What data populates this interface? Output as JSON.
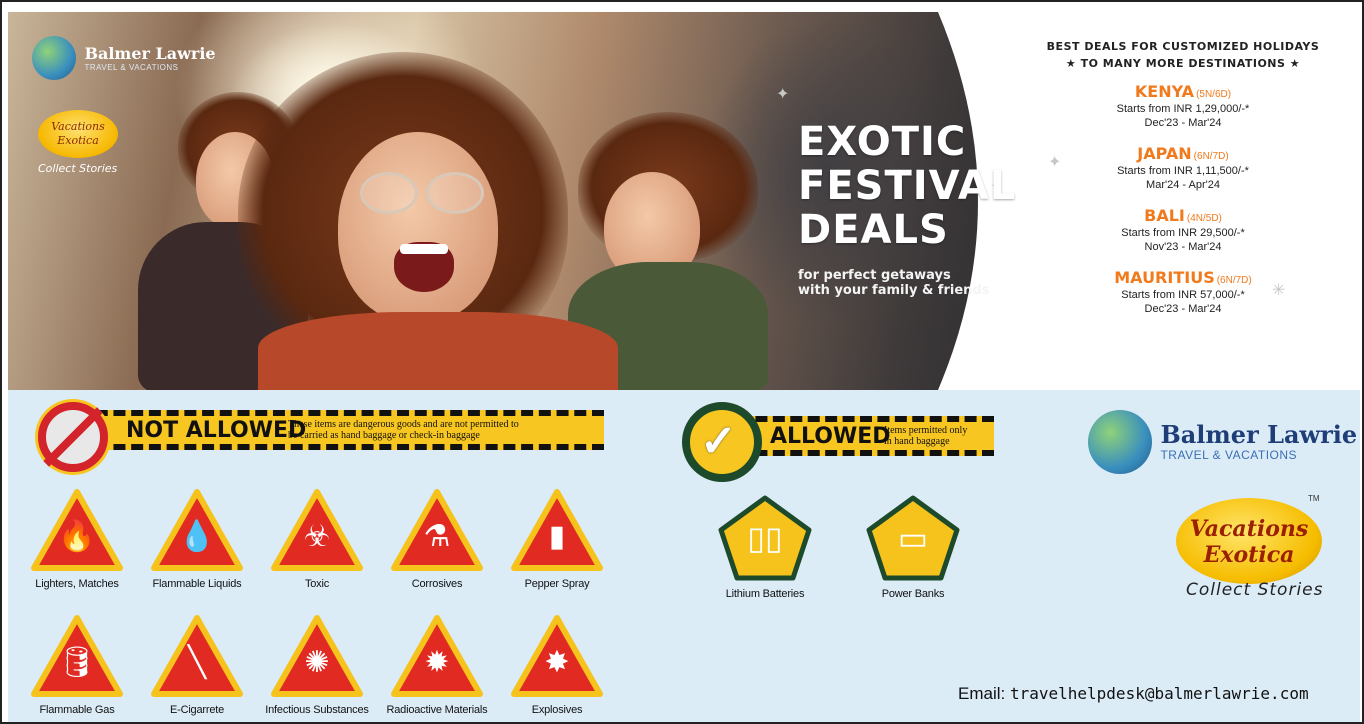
{
  "banner": {
    "headline": [
      "EXOTIC",
      "FESTIVAL",
      "DEALS"
    ],
    "subline": [
      "for perfect getaways",
      "with your family & friends"
    ],
    "brand": {
      "name": "Balmer Lawrie",
      "tagline": "TRAVEL & VACATIONS",
      "badge": [
        "Vacations",
        "Exotica"
      ],
      "motto": "Collect Stories"
    },
    "deals_heading": [
      "BEST DEALS FOR CUSTOMIZED HOLIDAYS",
      "★ TO MANY MORE DESTINATIONS ★"
    ],
    "deals": [
      {
        "destination": "KENYA",
        "duration": "(5N/6D)",
        "price": "Starts from INR 1,29,000/-*",
        "dates": "Dec'23 - Mar'24"
      },
      {
        "destination": "JAPAN",
        "duration": "(6N/7D)",
        "price": "Starts from INR 1,11,500/-*",
        "dates": "Mar'24 - Apr'24"
      },
      {
        "destination": "BALI",
        "duration": "(4N/5D)",
        "price": "Starts from INR 29,500/-*",
        "dates": "Nov'23 - Mar'24"
      },
      {
        "destination": "MAURITIUS",
        "duration": "(6N/7D)",
        "price": "Starts from INR 57,000/-*",
        "dates": "Dec'23 - Mar'24"
      }
    ],
    "colors": {
      "deal_accent": "#f07a1c"
    }
  },
  "not_allowed": {
    "title": "NOT ALLOWED",
    "note": [
      "These items are dangerous goods and are not permitted to",
      "be carried as hand baggage or check-in baggage"
    ],
    "items": [
      {
        "label": "Lighters, Matches",
        "icon": "lighter-icon"
      },
      {
        "label": "Flammable Liquids",
        "icon": "flame-drops-icon"
      },
      {
        "label": "Toxic",
        "icon": "biohazard-icon"
      },
      {
        "label": "Corrosives",
        "icon": "corrosive-icon"
      },
      {
        "label": "Pepper Spray",
        "icon": "spray-can-icon"
      },
      {
        "label": "Flammable Gas",
        "icon": "gas-cylinder-icon"
      },
      {
        "label": "E-Cigarrete",
        "icon": "e-cigarette-icon"
      },
      {
        "label": "Infectious Substances",
        "icon": "virus-icon"
      },
      {
        "label": "Radioactive Materials",
        "icon": "radiation-icon"
      },
      {
        "label": "Explosives",
        "icon": "explosion-icon"
      }
    ]
  },
  "allowed": {
    "title": "ALLOWED",
    "note": [
      "Items permitted only",
      "in hand baggage"
    ],
    "items": [
      {
        "label": "Lithium Batteries",
        "icon": "battery-icon"
      },
      {
        "label": "Power Banks",
        "icon": "power-bank-icon"
      }
    ]
  },
  "footer": {
    "brand_name": "Balmer Lawrie",
    "brand_tagline": "TRAVEL & VACATIONS",
    "badge": [
      "Vacations",
      "Exotica"
    ],
    "tm": "TM",
    "motto": "Collect Stories",
    "email_label": "Email:",
    "email": "travelhelpdesk@balmerlawrie.com"
  }
}
